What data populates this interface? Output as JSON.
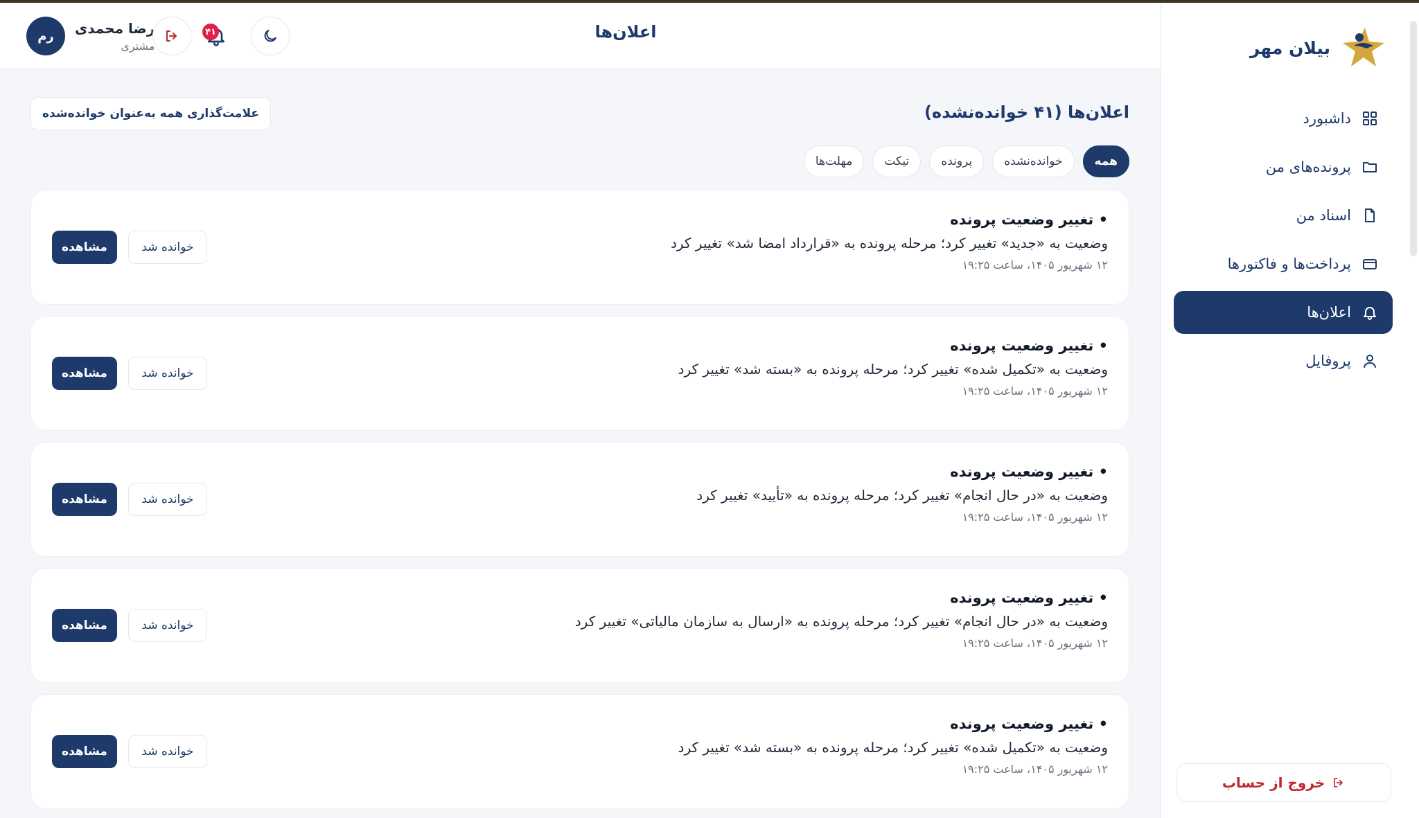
{
  "brand": {
    "name": "بیلان مهر"
  },
  "sidebar": {
    "items": [
      {
        "label": "داشبورد",
        "icon": "grid-icon",
        "active": false
      },
      {
        "label": "پرونده‌های من",
        "icon": "folder-icon",
        "active": false
      },
      {
        "label": "اسناد من",
        "icon": "file-icon",
        "active": false
      },
      {
        "label": "پرداخت‌ها و فاکتورها",
        "icon": "credit-card-icon",
        "active": false
      },
      {
        "label": "اعلان‌ها",
        "icon": "bell-icon",
        "active": true
      },
      {
        "label": "پروفایل",
        "icon": "user-icon",
        "active": false
      }
    ],
    "logout_label": "خروج از حساب"
  },
  "header": {
    "title": "اعلان‌ها",
    "user": {
      "name": "رضا محمدی",
      "role": "مشتری",
      "initials": "رم"
    },
    "notification_count": "۴۱"
  },
  "main": {
    "title": "اعلان‌ها (۴۱ خوانده‌نشده)",
    "mark_all_label": "علامت‌گذاری همه به‌عنوان خوانده‌شده",
    "filters": [
      "همه",
      "خوانده‌نشده",
      "پرونده",
      "تیکت",
      "مهلت‌ها"
    ],
    "active_filter": "همه",
    "read_label": "خوانده شد",
    "view_label": "مشاهده",
    "notifications": [
      {
        "title": "• تغییر وضعیت پرونده",
        "body": "وضعیت به «جدید» تغییر کرد؛ مرحله پرونده به «قرارداد امضا شد» تغییر کرد",
        "time": "۱۲ شهریور ۱۴۰۵، ساعت ۱۹:۲۵"
      },
      {
        "title": "• تغییر وضعیت پرونده",
        "body": "وضعیت به «تکمیل شده» تغییر کرد؛ مرحله پرونده به «بسته شد» تغییر کرد",
        "time": "۱۲ شهریور ۱۴۰۵، ساعت ۱۹:۲۵"
      },
      {
        "title": "• تغییر وضعیت پرونده",
        "body": "وضعیت به «در حال انجام» تغییر کرد؛ مرحله پرونده به «تأیید» تغییر کرد",
        "time": "۱۲ شهریور ۱۴۰۵، ساعت ۱۹:۲۵"
      },
      {
        "title": "• تغییر وضعیت پرونده",
        "body": "وضعیت به «در حال انجام» تغییر کرد؛ مرحله پرونده به «ارسال به سازمان مالیاتی» تغییر کرد",
        "time": "۱۲ شهریور ۱۴۰۵، ساعت ۱۹:۲۵"
      },
      {
        "title": "• تغییر وضعیت پرونده",
        "body": "وضعیت به «تکمیل شده» تغییر کرد؛ مرحله پرونده به «بسته شد» تغییر کرد",
        "time": "۱۲ شهریور ۱۴۰۵، ساعت ۱۹:۲۵"
      }
    ]
  },
  "colors": {
    "primary": "#1e3a6b",
    "danger": "#c0282f",
    "badge": "#e11d48",
    "logo_gold": "#d4a73a"
  }
}
